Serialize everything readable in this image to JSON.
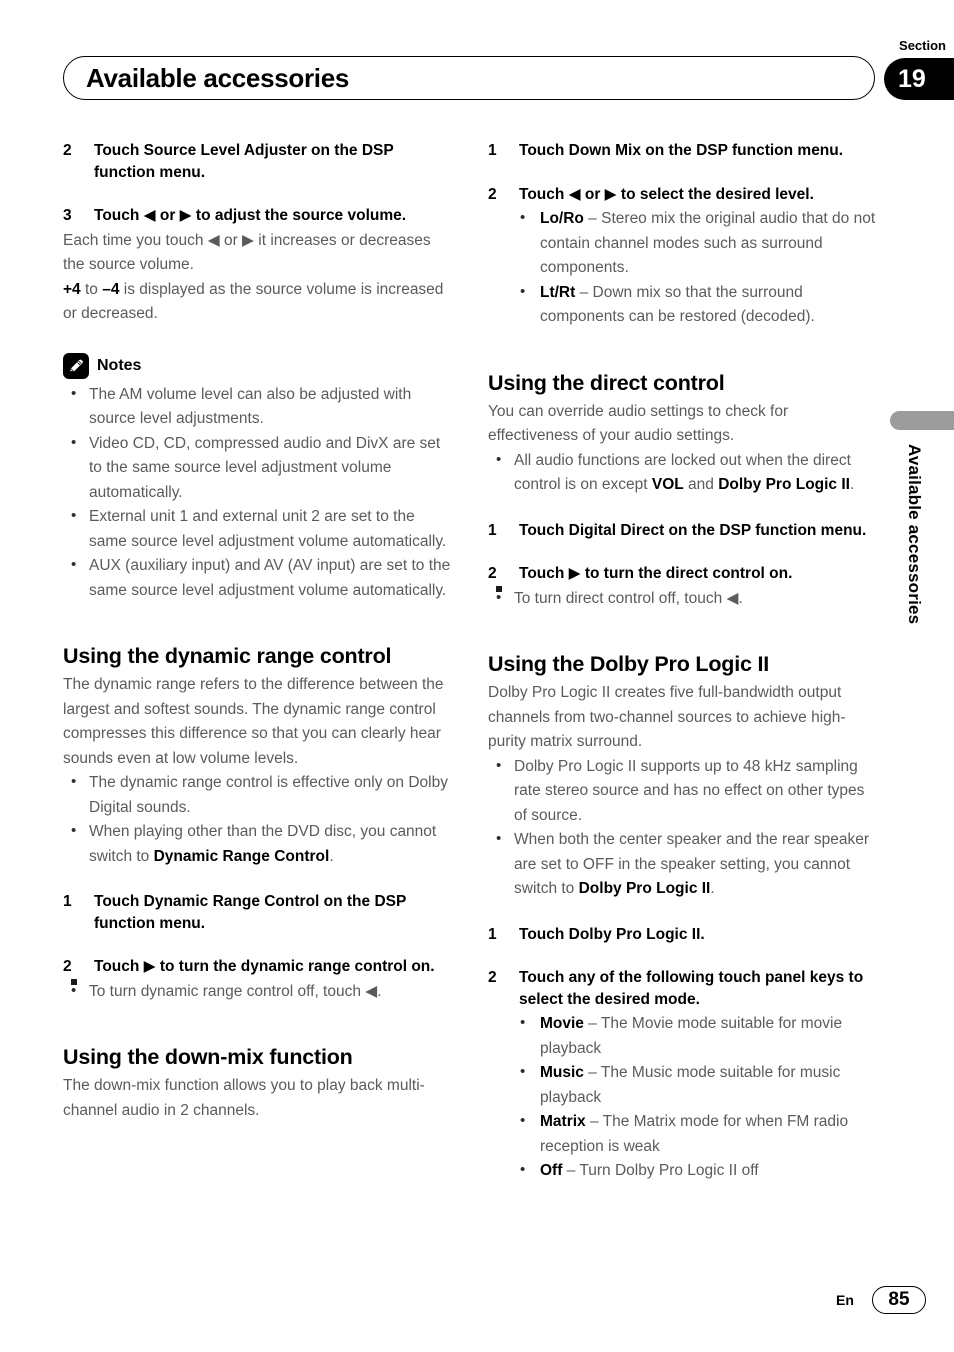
{
  "header": {
    "title": "Available accessories",
    "section_label": "Section",
    "section_number": "19"
  },
  "side_tab": {
    "vertical_label": "Available accessories"
  },
  "footer": {
    "language": "En",
    "page_number": "85"
  },
  "left_column": {
    "step2": {
      "num": "2",
      "text": "Touch Source Level Adjuster on the DSP function menu."
    },
    "step3": {
      "num": "3",
      "text": "Touch ◀ or ▶ to adjust the source volume."
    },
    "step3_body1": "Each time you touch ◀ or ▶ it increases or decreases the source volume.",
    "step3_body2_bold1": "+4",
    "step3_body2_mid": " to ",
    "step3_body2_bold2": "–4",
    "step3_body2_rest": " is displayed as the source volume is increased or decreased.",
    "notes_label": "Notes",
    "notes": [
      "The AM volume level can also be adjusted with source level adjustments.",
      "Video CD, CD, compressed audio and DivX are set to the same source level adjustment volume automatically.",
      "External unit 1 and external unit 2 are set to the same source level adjustment volume automatically.",
      "AUX (auxiliary input) and AV (AV input) are set to the same source level adjustment volume automatically."
    ],
    "drc_heading": "Using the dynamic range control",
    "drc_body": "The dynamic range refers to the difference between the largest and softest sounds. The dynamic range control compresses this difference so that you can clearly hear sounds even at low volume levels.",
    "drc_bullet1": "The dynamic range control is effective only on Dolby Digital sounds.",
    "drc_bullet2_pre": "When playing other than the DVD disc, you cannot switch to ",
    "drc_bullet2_bold": "Dynamic Range Control",
    "drc_bullet2_post": ".",
    "drc_step1": {
      "num": "1",
      "text": "Touch Dynamic Range Control on the DSP function menu."
    },
    "drc_step2": {
      "num": "2",
      "text": "Touch ▶ to turn the dynamic range control on."
    },
    "drc_step2_note": "To turn dynamic range control off, touch ◀.",
    "downmix_heading": "Using the down-mix function",
    "downmix_body": "The down-mix function allows you to play back multi-channel audio in 2 channels."
  },
  "right_column": {
    "dm_step1": {
      "num": "1",
      "text": "Touch Down Mix on the DSP function menu."
    },
    "dm_step2": {
      "num": "2",
      "text": "Touch ◀ or ▶ to select the desired level."
    },
    "dm_options": [
      {
        "term": "Lo/Ro",
        "desc": " – Stereo mix the original audio that do not contain channel modes such as surround components."
      },
      {
        "term": "Lt/Rt",
        "desc": " – Down mix so that the surround components can be restored (decoded)."
      }
    ],
    "direct_heading": "Using the direct control",
    "direct_body": "You can override audio settings to check for effectiveness of your audio settings.",
    "direct_bullet_pre": "All audio functions are locked out when the direct control is on except ",
    "direct_bullet_bold1": "VOL",
    "direct_bullet_mid": " and ",
    "direct_bullet_bold2": "Dolby Pro Logic II",
    "direct_bullet_post": ".",
    "direct_step1": {
      "num": "1",
      "text": "Touch Digital Direct on the DSP function menu."
    },
    "direct_step2": {
      "num": "2",
      "text": "Touch ▶ to turn the direct control on."
    },
    "direct_step2_note": "To turn direct control off, touch ◀.",
    "dpl_heading": "Using the Dolby Pro Logic II",
    "dpl_body": "Dolby Pro Logic II creates five full-bandwidth output channels from two-channel sources to achieve high-purity matrix surround.",
    "dpl_bullet1": "Dolby Pro Logic II supports up to 48 kHz sampling rate stereo source and has no effect on other types of source.",
    "dpl_bullet2_pre": "When both the center speaker and the rear speaker are set to OFF in the speaker setting, you cannot switch to ",
    "dpl_bullet2_bold": "Dolby Pro Logic II",
    "dpl_bullet2_post": ".",
    "dpl_step1": {
      "num": "1",
      "text": "Touch Dolby Pro Logic II."
    },
    "dpl_step2": {
      "num": "2",
      "text": "Touch any of the following touch panel keys to select the desired mode."
    },
    "dpl_modes": [
      {
        "term": "Movie",
        "desc": " – The Movie mode suitable for movie playback"
      },
      {
        "term": "Music",
        "desc": " – The Music mode suitable for music playback"
      },
      {
        "term": "Matrix",
        "desc": " – The Matrix mode for when FM radio reception is weak"
      },
      {
        "term": "Off",
        "desc": " – Turn Dolby Pro Logic II off"
      }
    ]
  }
}
